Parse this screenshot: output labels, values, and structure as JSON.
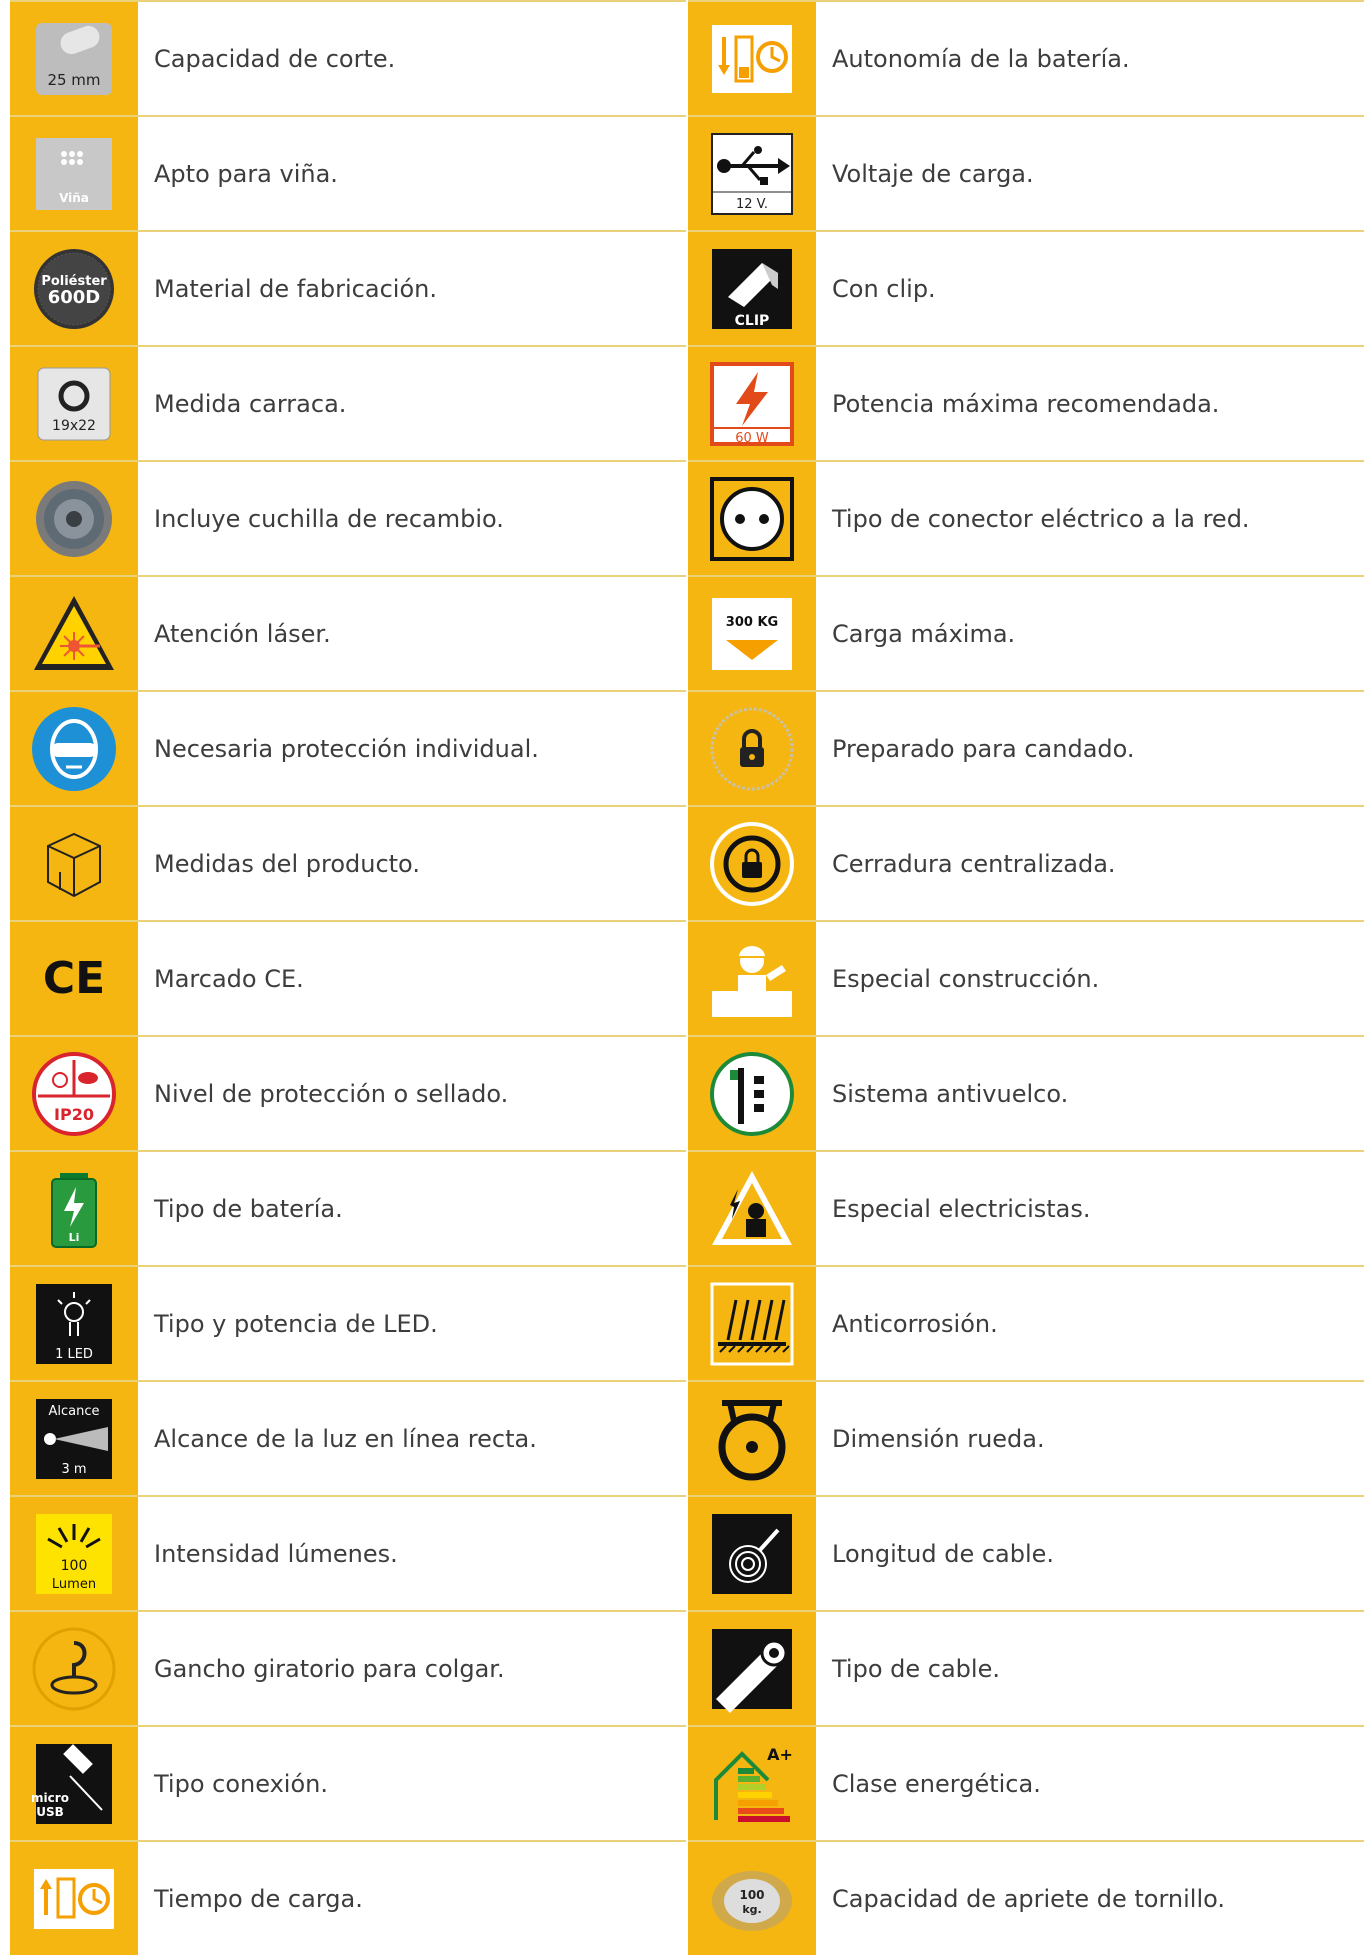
{
  "left_column": [
    {
      "icon": "cutting-capacity-icon",
      "icon_text": "25 mm",
      "label": "Capacidad de corte."
    },
    {
      "icon": "vineyard-icon",
      "icon_text": "Viña",
      "label": "Apto para viña."
    },
    {
      "icon": "polyester-material-icon",
      "icon_text": "Poliéster 600D",
      "label": "Material de fabricación."
    },
    {
      "icon": "ratchet-size-icon",
      "icon_text": "19x22",
      "label": "Medida carraca."
    },
    {
      "icon": "spare-blade-icon",
      "icon_text": "",
      "label": "Incluye cuchilla de recambio."
    },
    {
      "icon": "laser-warning-icon",
      "icon_text": "",
      "label": "Atención láser."
    },
    {
      "icon": "eye-protection-icon",
      "icon_text": "",
      "label": "Necesaria protección individual."
    },
    {
      "icon": "product-dimensions-icon",
      "icon_text": "",
      "label": "Medidas del producto."
    },
    {
      "icon": "ce-mark-icon",
      "icon_text": "CE",
      "label": "Marcado CE."
    },
    {
      "icon": "ip-rating-icon",
      "icon_text": "IP20",
      "label": "Nivel de protección o sellado."
    },
    {
      "icon": "battery-type-icon",
      "icon_text": "Li",
      "label": "Tipo de batería."
    },
    {
      "icon": "led-icon",
      "icon_text": "1 LED",
      "label": "Tipo y potencia de LED."
    },
    {
      "icon": "light-range-icon",
      "icon_text": "Alcance|3 m",
      "label": "Alcance de la luz en línea recta."
    },
    {
      "icon": "lumen-icon",
      "icon_text": "100|Lumen",
      "label": "Intensidad lúmenes."
    },
    {
      "icon": "swivel-hook-icon",
      "icon_text": "",
      "label": "Gancho giratorio para colgar."
    },
    {
      "icon": "micro-usb-icon",
      "icon_text": "micro|USB",
      "label": "Tipo conexión."
    },
    {
      "icon": "charging-time-icon",
      "icon_text": "",
      "label": "Tiempo de carga."
    }
  ],
  "right_column": [
    {
      "icon": "battery-autonomy-icon",
      "icon_text": "",
      "label": "Autonomía de la batería."
    },
    {
      "icon": "usb-charging-voltage-icon",
      "icon_text": "12 V.",
      "label": "Voltaje de carga."
    },
    {
      "icon": "clip-icon",
      "icon_text": "CLIP",
      "label": "Con clip."
    },
    {
      "icon": "max-power-icon",
      "icon_text": "60 W",
      "label": "Potencia máxima recomendada."
    },
    {
      "icon": "power-socket-icon",
      "icon_text": "",
      "label": "Tipo de conector eléctrico a la red."
    },
    {
      "icon": "max-load-icon",
      "icon_text": "300 KG",
      "label": "Carga máxima."
    },
    {
      "icon": "padlock-icon",
      "icon_text": "",
      "label": "Preparado para candado."
    },
    {
      "icon": "central-lock-icon",
      "icon_text": "",
      "label": "Cerradura centralizada."
    },
    {
      "icon": "construction-worker-icon",
      "icon_text": "",
      "label": "Especial construcción."
    },
    {
      "icon": "anti-tip-icon",
      "icon_text": "",
      "label": "Sistema antivuelco."
    },
    {
      "icon": "electrician-icon",
      "icon_text": "",
      "label": "Especial electricistas."
    },
    {
      "icon": "anticorrosion-icon",
      "icon_text": "",
      "label": "Anticorrosión."
    },
    {
      "icon": "wheel-icon",
      "icon_text": "",
      "label": "Dimensión rueda."
    },
    {
      "icon": "cable-length-icon",
      "icon_text": "",
      "label": "Longitud de cable."
    },
    {
      "icon": "cable-type-icon",
      "icon_text": "",
      "label": "Tipo de cable."
    },
    {
      "icon": "energy-class-icon",
      "icon_text": "A+",
      "label": "Clase energética."
    },
    {
      "icon": "screw-tightening-icon",
      "icon_text": "100|kg.",
      "label": "Capacidad de apriete de tornillo."
    }
  ],
  "colors": {
    "icon_cell": "#f5b612",
    "divider": "#e9d27a",
    "text": "#3d3d3d"
  }
}
